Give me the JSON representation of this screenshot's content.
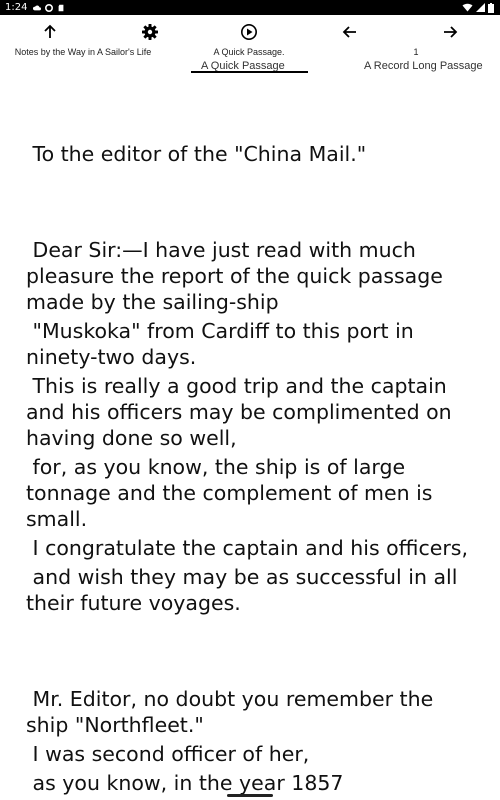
{
  "status_bar": {
    "time": "1:24",
    "icons": [
      "cloud-icon",
      "data-saver-icon",
      "sd-card-icon",
      "wifi-icon",
      "signal-icon",
      "battery-icon"
    ]
  },
  "toolbar": {
    "book_title": "Notes by the Way in A Sailor's Life",
    "current_chapter": "A Quick Passage.",
    "page_number": "1",
    "icons": {
      "up": "arrow-up-icon",
      "settings": "gear-icon",
      "play": "play-circle-icon",
      "back": "arrow-left-icon",
      "forward": "arrow-right-icon"
    }
  },
  "chapter_tabs": {
    "active": "A Quick Passage",
    "next": "A Record Long Passage"
  },
  "content": {
    "paragraphs": [
      " To the editor of the \"China Mail.\"",
      " Dear Sir:—I have just read with much pleasure the report of the quick passage made by the sailing-ship",
      " \"Muskoka\" from Cardiff to this port in ninety-two days.",
      " This is really a good trip and the captain and his officers may be complimented on having done so well,",
      " for, as you know, the ship is of large tonnage and the complement of men is small.",
      " I congratulate the captain and his officers,",
      " and wish they may be as successful in all their future voyages.",
      " Mr. Editor, no doubt you remember the ship \"Northfleet.\"",
      " I was second officer of her,",
      " as you know, in the year 1857"
    ]
  },
  "colors": {
    "status_bar_bg": "#000000",
    "page_bg": "#ffffff",
    "text": "#111111"
  }
}
